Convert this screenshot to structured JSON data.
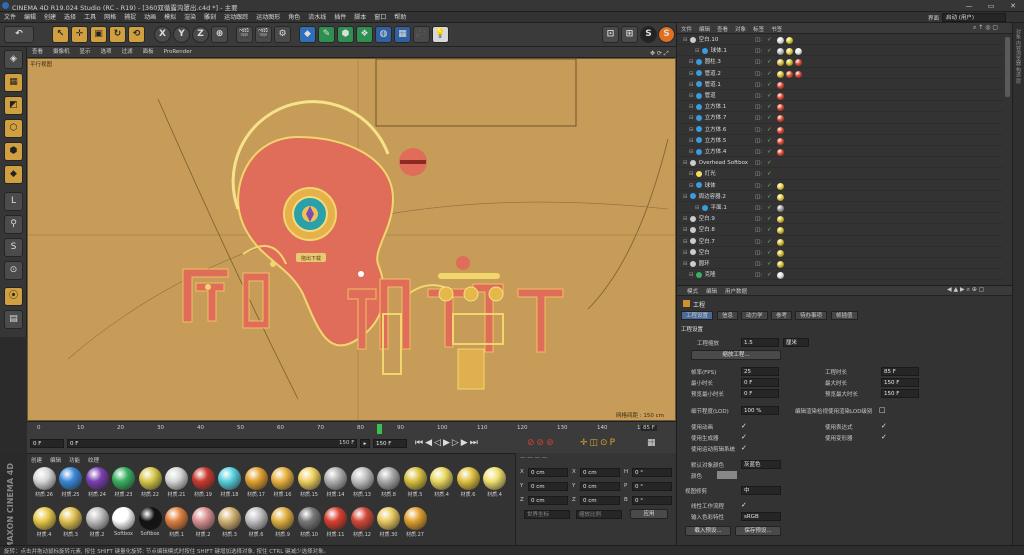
{
  "window": {
    "title": "CINEMA 4D R19.024 Studio (RC - R19) - [360双循露沟罩出.c4d *] - 主要",
    "min": "—",
    "max": "▭",
    "close": "✕"
  },
  "menu": [
    "文件",
    "编辑",
    "创建",
    "选择",
    "工具",
    "网格",
    "捕捉",
    "动画",
    "模拟",
    "渲染",
    "雕刻",
    "运动跟踪",
    "运动图形",
    "角色",
    "流水线",
    "插件",
    "脚本",
    "窗口",
    "帮助"
  ],
  "layout": {
    "label": "界面",
    "value": "启动 (用户)"
  },
  "toolbar": {
    "undo": "↶",
    "redo": "↷",
    "x": "X",
    "y": "Y",
    "z": "Z",
    "s1": "S",
    "s2": "S"
  },
  "viewport": {
    "menu": [
      "查看",
      "摄像机",
      "显示",
      "选项",
      "过滤",
      "面板",
      "ProRender"
    ],
    "label": "平行视图",
    "scale": "网格间距 : 150 cm",
    "tooltip": "拖出下载"
  },
  "timeline": {
    "ticks": [
      "0",
      "10",
      "20",
      "30",
      "40",
      "50",
      "60",
      "70",
      "80",
      "90",
      "100",
      "110",
      "120",
      "130",
      "140",
      "150"
    ],
    "current": "85 F",
    "start": "0 F",
    "startB": "0 F",
    "end": "150 F",
    "endB": "150 F"
  },
  "materials": {
    "menu": [
      "创建",
      "编辑",
      "功能",
      "纹理"
    ],
    "items": [
      {
        "name": "材质.26",
        "color": "#d8d8d8"
      },
      {
        "name": "材质.25",
        "color": "#3a88d8"
      },
      {
        "name": "材质.24",
        "color": "#7a3fb0"
      },
      {
        "name": "材质.23",
        "color": "#38b060"
      },
      {
        "name": "材质.22",
        "color": "#d8c84a"
      },
      {
        "name": "材质.21",
        "color": "#d6d6d6"
      },
      {
        "name": "材质.19",
        "color": "#c83a30"
      },
      {
        "name": "材质.18",
        "color": "#58d0e0"
      },
      {
        "name": "材质.17",
        "color": "#e0a030"
      },
      {
        "name": "材质.16",
        "color": "#e8b040"
      },
      {
        "name": "材质.15",
        "color": "#f0d060"
      },
      {
        "name": "材质.14",
        "color": "#b0b0b0"
      },
      {
        "name": "材质.13",
        "color": "#c0c0c0"
      },
      {
        "name": "材质.8",
        "color": "#a8a8a8"
      },
      {
        "name": "材质.5",
        "color": "#d8c040"
      },
      {
        "name": "材质.4",
        "color": "#e8d860"
      },
      {
        "name": "材质.6",
        "color": "#e0c040"
      },
      {
        "name": "材质.4",
        "color": "#f0e070"
      },
      {
        "name": "材质.4",
        "color": "#e8c848"
      },
      {
        "name": "材质.3",
        "color": "#e0c050"
      },
      {
        "name": "材质.2",
        "color": "#bdbdbd"
      },
      {
        "name": "Softbox",
        "color": "#ffffff"
      },
      {
        "name": "Softbox",
        "color": "#111111"
      },
      {
        "name": "材质.1",
        "color": "#e08040"
      },
      {
        "name": "材质.2",
        "color": "#d89090"
      },
      {
        "name": "材质.3",
        "color": "#d0b070"
      },
      {
        "name": "材质.6",
        "color": "#c0c0c0"
      },
      {
        "name": "材质.9",
        "color": "#e0b040"
      },
      {
        "name": "材质.10",
        "color": "#787878"
      },
      {
        "name": "材质.11",
        "color": "#d84030"
      },
      {
        "name": "材质.12",
        "color": "#d04838"
      },
      {
        "name": "材质.30",
        "color": "#e8c860"
      },
      {
        "name": "材质.27",
        "color": "#e0a030"
      }
    ]
  },
  "coords": {
    "x": "X",
    "y": "Y",
    "z": "Z",
    "xv": "0 cm",
    "yv": "0 cm",
    "zv": "0 cm",
    "hx": "X",
    "hy": "Y",
    "hz": "Z",
    "hv": "0 cm",
    "h": "H",
    "p": "P",
    "b": "B",
    "deg": "0 °",
    "d1": "世界坐标",
    "d2": "缩放比例",
    "apply": "应用"
  },
  "objects": {
    "menu": [
      "文件",
      "编辑",
      "查看",
      "对象",
      "标签",
      "书签"
    ],
    "rows": [
      {
        "name": "空白.10",
        "color": "#cccccc",
        "indent": 0,
        "tags": [
          "#e0e0e0",
          "#d8d030"
        ]
      },
      {
        "name": "球体.1",
        "color": "#3a9be0",
        "indent": 2,
        "tags": [
          "#c0c0c0",
          "#e8d040",
          "#e8e8e8"
        ]
      },
      {
        "name": "圆柱.3",
        "color": "#3a9be0",
        "indent": 1,
        "tags": [
          "#e0c040",
          "#d8c030",
          "#e04830"
        ]
      },
      {
        "name": "管道.2",
        "color": "#3a9be0",
        "indent": 1,
        "tags": [
          "#d8c030",
          "#e05030",
          "#e04030"
        ]
      },
      {
        "name": "管道.1",
        "color": "#3a9be0",
        "indent": 1,
        "tags": [
          "#e04830"
        ]
      },
      {
        "name": "管道",
        "color": "#3a9be0",
        "indent": 1,
        "tags": [
          "#e04830"
        ]
      },
      {
        "name": "立方体.1",
        "color": "#3a9be0",
        "indent": 1,
        "tags": [
          "#e04830"
        ]
      },
      {
        "name": "立方体.7",
        "color": "#3a9be0",
        "indent": 1,
        "tags": [
          "#e04830"
        ]
      },
      {
        "name": "立方体.6",
        "color": "#3a9be0",
        "indent": 1,
        "tags": [
          "#e04830"
        ]
      },
      {
        "name": "立方体.5",
        "color": "#3a9be0",
        "indent": 1,
        "tags": [
          "#e04830"
        ]
      },
      {
        "name": "立方体.4",
        "color": "#3a9be0",
        "indent": 1,
        "tags": [
          "#e04830"
        ]
      },
      {
        "name": "Overhead Softbox",
        "color": "#cccccc",
        "indent": 0,
        "tags": []
      },
      {
        "name": "灯光",
        "color": "#f0e060",
        "indent": 1,
        "tags": []
      },
      {
        "name": "球体",
        "color": "#3a9be0",
        "indent": 1,
        "tags": [
          "#e8d040"
        ]
      },
      {
        "name": "周边容器.2",
        "color": "#3a9be0",
        "indent": 0,
        "tags": [
          "#e8d040"
        ]
      },
      {
        "name": "平面.1",
        "color": "#3a9be0",
        "indent": 2,
        "tags": [
          "#a0a0a0"
        ]
      },
      {
        "name": "空白.9",
        "color": "#cccccc",
        "indent": 0,
        "tags": [
          "#d8c030"
        ]
      },
      {
        "name": "空白.8",
        "color": "#cccccc",
        "indent": 0,
        "tags": [
          "#d8c030"
        ]
      },
      {
        "name": "空白.7",
        "color": "#cccccc",
        "indent": 0,
        "tags": [
          "#d8c030"
        ]
      },
      {
        "name": "空白",
        "color": "#cccccc",
        "indent": 0,
        "tags": [
          "#d8c030"
        ]
      },
      {
        "name": "圆环",
        "color": "#cccccc",
        "indent": 0,
        "tags": [
          "#d8c030"
        ]
      },
      {
        "name": "克隆",
        "color": "#38b060",
        "indent": 1,
        "tags": [
          "#e0e0e0"
        ]
      }
    ]
  },
  "attr": {
    "menu": [
      "模式",
      "编辑",
      "用户数据"
    ],
    "title": "工程",
    "tabs": [
      "工程设置",
      "信息",
      "动力学",
      "参考",
      "待办事项",
      "帧插值"
    ],
    "section": "工程设置",
    "scale_label": "工程缩放",
    "scale_value": "1.5",
    "scale_unit": "厘米",
    "scale_btn": "缩放工程...",
    "fps_label": "帧率(FPS)",
    "fps": "25",
    "time_label": "工程时长",
    "time": "85 F",
    "min_label": "最小时长",
    "min": "0 F",
    "max_label": "最大时长",
    "max": "150 F",
    "pmin_label": "预览最小时长",
    "pmin": "0 F",
    "pmax_label": "预览最大时长",
    "pmax": "150 F",
    "lod_label": "细节程度(LOD)",
    "lod": "100 %",
    "lod_chk": "编辑渲染检视使用渲染LOD级别",
    "anim": "使用动画",
    "expr": "使用表达式",
    "gen": "使用生成器",
    "deform": "使用变形器",
    "motion": "使用运动剪辑系统",
    "objcolor_label": "默认对象颜色",
    "objcolor": "灰蓝色",
    "color_label": "颜色",
    "view_label": "视图修剪",
    "view": "中",
    "linear": "线性工作流程",
    "inputcs_label": "输入色彩特性",
    "inputcs": "sRGB",
    "btn_load": "载入预设...",
    "btn_save": "保存预设..."
  },
  "status": "旋转：点击并拖动鼠标旋转元素, 按住 SHIFT 键量化旋转; 节点编辑模式时按住 SHIFT 键增加选择对象, 按住 CTRL 键减少选择对象。",
  "colors": {
    "bg": "#c69c58",
    "red": "#e06c5a",
    "gold": "#f1d66e",
    "teal": "#2aa0a8"
  }
}
